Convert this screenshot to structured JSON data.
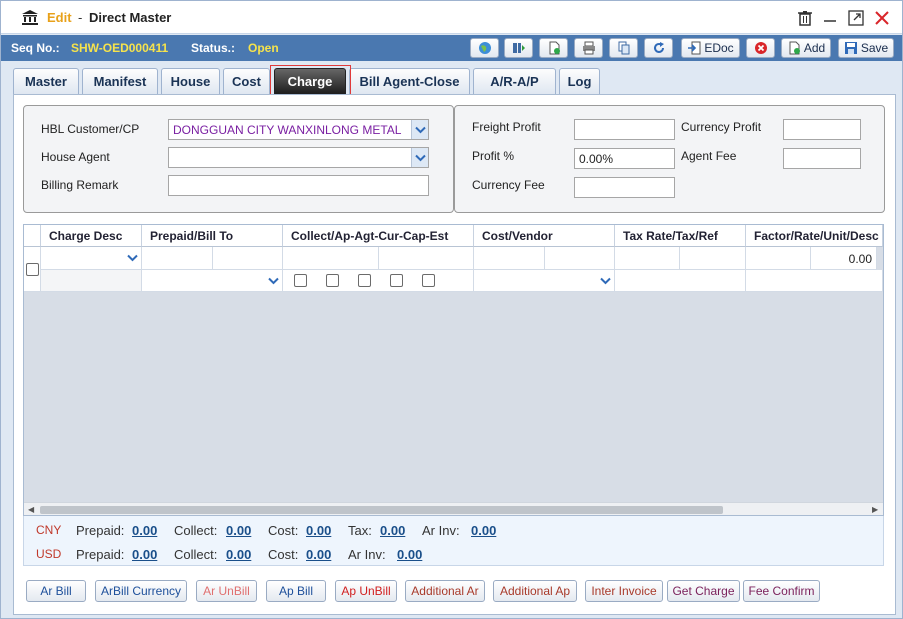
{
  "titlebar": {
    "mode": "Edit",
    "separator": "-",
    "title": "Direct Master"
  },
  "infobar": {
    "seq_label": "Seq No.:",
    "seq_value": "SHW-OED000411",
    "status_label": "Status.:",
    "status_value": "Open"
  },
  "toolbar": {
    "edoc_label": "EDoc",
    "add_label": "Add",
    "save_label": "Save"
  },
  "tabs": [
    {
      "label": "Master"
    },
    {
      "label": "Manifest"
    },
    {
      "label": "House"
    },
    {
      "label": "Cost"
    },
    {
      "label": "Charge"
    },
    {
      "label": "Bill Agent-Close"
    },
    {
      "label": "A/R-A/P"
    },
    {
      "label": "Log"
    }
  ],
  "active_tab": "Charge",
  "left_panel": {
    "hbl_customer_label": "HBL Customer/CP",
    "hbl_customer_value": "DONGGUAN CITY WANXINLONG METAL",
    "house_agent_label": "House Agent",
    "house_agent_value": "",
    "billing_remark_label": "Billing Remark",
    "billing_remark_value": ""
  },
  "right_panel": {
    "freight_profit_label": "Freight Profit",
    "freight_profit_value": "",
    "currency_profit_label": "Currency Profit",
    "currency_profit_value": "",
    "profit_pct_label": "Profit %",
    "profit_pct_value": "0.00%",
    "agent_fee_label": "Agent Fee",
    "agent_fee_value": "",
    "currency_fee_label": "Currency Fee",
    "currency_fee_value": ""
  },
  "grid": {
    "columns": [
      "Charge Desc",
      "Prepaid/Bill To",
      "Collect/Ap-Agt-Cur-Cap-Est",
      "Cost/Vendor",
      "Tax Rate/Tax/Ref",
      "Factor/Rate/Unit/Desc"
    ],
    "row1_amount": "0.00"
  },
  "totals": {
    "cny": {
      "currency": "CNY",
      "prepaid_label": "Prepaid:",
      "prepaid": "0.00",
      "collect_label": "Collect:",
      "collect": "0.00",
      "cost_label": "Cost:",
      "cost": "0.00",
      "tax_label": "Tax:",
      "tax": "0.00",
      "arinv_label": "Ar Inv:",
      "arinv": "0.00"
    },
    "usd": {
      "currency": "USD",
      "prepaid_label": "Prepaid:",
      "prepaid": "0.00",
      "collect_label": "Collect:",
      "collect": "0.00",
      "cost_label": "Cost:",
      "cost": "0.00",
      "arinv_label": "Ar Inv:",
      "arinv": "0.00"
    }
  },
  "actions": [
    {
      "label": "Ar Bill",
      "color": "#1d4f9a"
    },
    {
      "label": "ArBill Currency",
      "color": "#1d4f9a"
    },
    {
      "label": "Ar UnBill",
      "color": "#e07070"
    },
    {
      "label": "Ap Bill",
      "color": "#1d4f9a"
    },
    {
      "label": "Ap UnBill",
      "color": "#d11f1f"
    },
    {
      "label": "Additional Ar",
      "color": "#a83a2a"
    },
    {
      "label": "Additional Ap",
      "color": "#a83a2a"
    },
    {
      "label": "Inter Invoice",
      "color": "#a83a2a"
    },
    {
      "label": "Get Charge",
      "color": "#7a1f5a"
    },
    {
      "label": "Fee Confirm",
      "color": "#7a1f5a"
    }
  ],
  "colors": {
    "accent": "#4a78b0",
    "status_value": "#f6e34c",
    "mode": "#e8a11a"
  },
  "icons": {
    "title": "bank-icon",
    "window": [
      "trash-icon",
      "minimize-icon",
      "maximize-icon",
      "close-icon"
    ],
    "toolbar": [
      "globe-icon",
      "columns-icon",
      "new-doc-icon",
      "print-icon",
      "copy-icon",
      "refresh-icon",
      "edoc-icon",
      "delete-icon",
      "add-icon",
      "save-icon"
    ]
  }
}
